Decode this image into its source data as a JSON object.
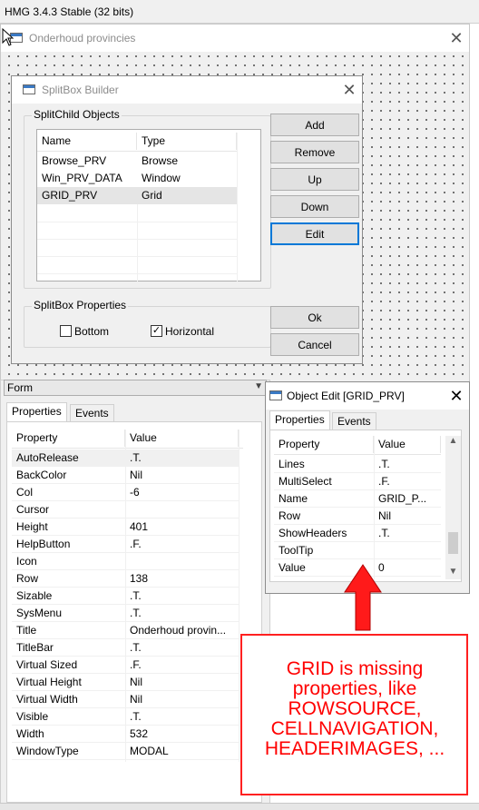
{
  "app_title": "HMG 3.4.3 Stable (32 bits)",
  "form_window": {
    "title": "Onderhoud provincies"
  },
  "splitbox_dialog": {
    "title": "SplitBox Builder",
    "child_group_title": "SplitChild Objects",
    "columns": [
      "Name",
      "Type"
    ],
    "rows": [
      {
        "name": "Browse_PRV",
        "type": "Browse"
      },
      {
        "name": "Win_PRV_DATA",
        "type": "Window"
      },
      {
        "name": "GRID_PRV",
        "type": "Grid"
      }
    ],
    "selected_row": 2,
    "buttons": {
      "add": "Add",
      "remove": "Remove",
      "up": "Up",
      "down": "Down",
      "edit": "Edit",
      "ok": "Ok",
      "cancel": "Cancel"
    },
    "props_group_title": "SplitBox Properties",
    "bottom_label": "Bottom",
    "bottom_checked": false,
    "horizontal_label": "Horizontal",
    "horizontal_checked": true,
    "check_mark": "✓"
  },
  "inspector": {
    "combo_value": "Form",
    "tabs": [
      "Properties",
      "Events"
    ],
    "columns": [
      "Property",
      "Value"
    ],
    "rows": [
      {
        "p": "AutoRelease",
        "v": ".T."
      },
      {
        "p": "BackColor",
        "v": "Nil"
      },
      {
        "p": "Col",
        "v": "-6"
      },
      {
        "p": "Cursor",
        "v": ""
      },
      {
        "p": "Height",
        "v": "401"
      },
      {
        "p": "HelpButton",
        "v": ".F."
      },
      {
        "p": "Icon",
        "v": ""
      },
      {
        "p": "Row",
        "v": "138"
      },
      {
        "p": "Sizable",
        "v": ".T."
      },
      {
        "p": "SysMenu",
        "v": ".T."
      },
      {
        "p": "Title",
        "v": "Onderhoud provin..."
      },
      {
        "p": "TitleBar",
        "v": ".T."
      },
      {
        "p": "Virtual Sized",
        "v": ".F."
      },
      {
        "p": "Virtual Height",
        "v": "Nil"
      },
      {
        "p": "Virtual Width",
        "v": "Nil"
      },
      {
        "p": "Visible",
        "v": ".T."
      },
      {
        "p": "Width",
        "v": "532"
      },
      {
        "p": "WindowType",
        "v": "MODAL"
      }
    ]
  },
  "object_edit": {
    "title": "Object Edit [GRID_PRV]",
    "tabs": [
      "Properties",
      "Events"
    ],
    "columns": [
      "Property",
      "Value"
    ],
    "rows": [
      {
        "p": "Lines",
        "v": ".T."
      },
      {
        "p": "MultiSelect",
        "v": ".F."
      },
      {
        "p": "Name",
        "v": "GRID_P..."
      },
      {
        "p": "Row",
        "v": "Nil"
      },
      {
        "p": "ShowHeaders",
        "v": ".T."
      },
      {
        "p": "ToolTip",
        "v": ""
      },
      {
        "p": "Value",
        "v": "0"
      }
    ]
  },
  "annotation": {
    "text": "GRID is missing properties, like ROWSOURCE, CELLNAVIGATION, HEADERIMAGES, ...",
    "color": "#ff0000"
  }
}
